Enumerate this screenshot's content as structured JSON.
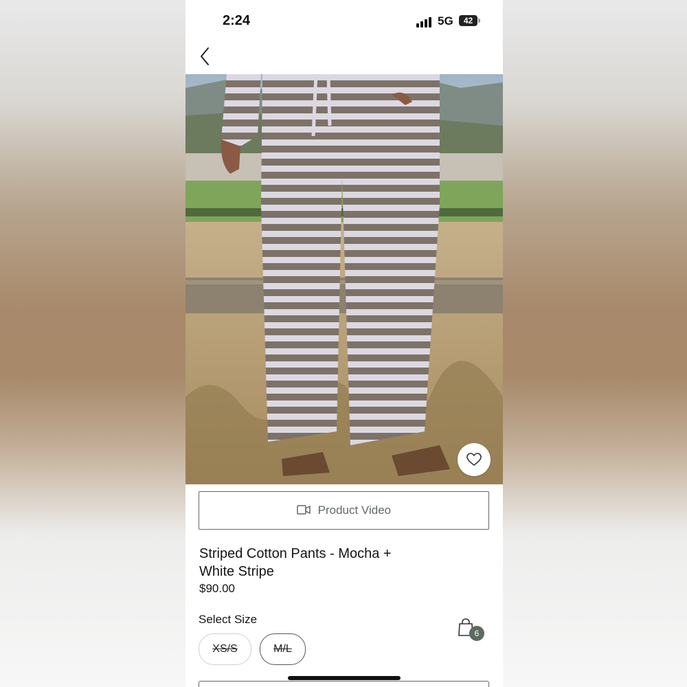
{
  "status_bar": {
    "time": "2:24",
    "network": "5G",
    "battery": "42"
  },
  "nav": {
    "back_icon": "chevron-left-icon"
  },
  "product": {
    "image_description_icon": "product-photo",
    "video_button_label": "Product Video",
    "title": "Striped Cotton Pants - Mocha + White Stripe",
    "price": "$90.00",
    "favorite_icon": "heart-icon"
  },
  "size_selector": {
    "label": "Select Size",
    "options": [
      {
        "label": "XS/S",
        "available": false,
        "selected": false
      },
      {
        "label": "M/L",
        "available": false,
        "selected": true
      }
    ]
  },
  "cart": {
    "icon": "shopping-bag-icon",
    "count": "6"
  },
  "colors": {
    "accent": "#5b6b60",
    "text": "#151515",
    "stripe_mocha": "#7d7268",
    "stripe_white": "#dcd8e2"
  }
}
